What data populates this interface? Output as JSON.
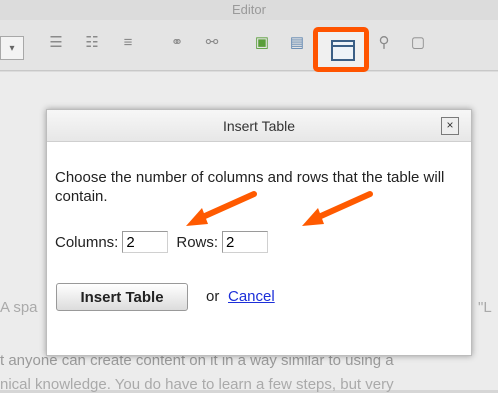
{
  "window": {
    "title": "Editor"
  },
  "toolbar": {
    "icons": [
      "select-dropdown-icon",
      "ordered-list-icon",
      "unordered-list-icon",
      "horizontal-rule-icon",
      "link-icon",
      "unlink-icon",
      "image-icon",
      "media-icon",
      "table-icon",
      "anchor-icon",
      "special-char-icon"
    ]
  },
  "dialog": {
    "title": "Insert Table",
    "close_label": "×",
    "instructions": "Choose the number of columns and rows that the table will contain.",
    "columns_label": "Columns:",
    "columns_value": "2",
    "rows_label": "Rows:",
    "rows_value": "2",
    "insert_label": "Insert Table",
    "or_text": "or",
    "cancel_label": "Cancel"
  },
  "background_text": {
    "line1_left": "A spa",
    "line1_right": "\"L",
    "line2": "t anyone can create content on it in a way similar to using a",
    "line3": "nical knowledge. You do have to learn a few steps, but very"
  },
  "colors": {
    "highlight": "#ff5400",
    "arrow": "#ff5a00",
    "link": "#1c2fd9"
  }
}
